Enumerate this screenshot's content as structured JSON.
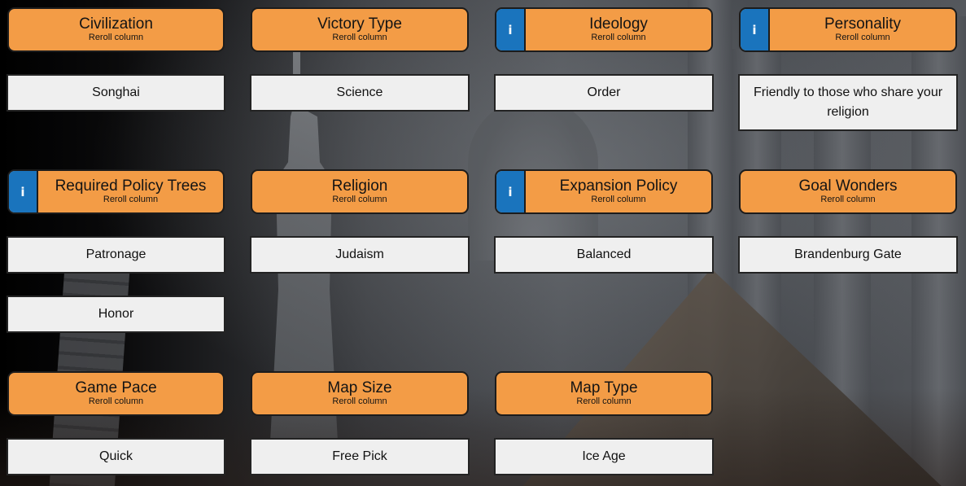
{
  "columns": {
    "civilization": {
      "title": "Civilization",
      "subtitle": "Reroll column",
      "has_info": false,
      "values": [
        "Songhai"
      ]
    },
    "victory_type": {
      "title": "Victory Type",
      "subtitle": "Reroll column",
      "has_info": false,
      "values": [
        "Science"
      ]
    },
    "ideology": {
      "title": "Ideology",
      "subtitle": "Reroll column",
      "has_info": true,
      "values": [
        "Order"
      ]
    },
    "personality": {
      "title": "Personality",
      "subtitle": "Reroll column",
      "has_info": true,
      "values": [
        "Friendly to those who share your religion"
      ]
    },
    "required_policy_trees": {
      "title": "Required Policy Trees",
      "subtitle": "Reroll column",
      "has_info": true,
      "values": [
        "Patronage",
        "Honor"
      ]
    },
    "religion": {
      "title": "Religion",
      "subtitle": "Reroll column",
      "has_info": false,
      "values": [
        "Judaism"
      ]
    },
    "expansion_policy": {
      "title": "Expansion Policy",
      "subtitle": "Reroll column",
      "has_info": true,
      "values": [
        "Balanced"
      ]
    },
    "goal_wonders": {
      "title": "Goal Wonders",
      "subtitle": "Reroll column",
      "has_info": false,
      "values": [
        "Brandenburg Gate"
      ]
    },
    "game_pace": {
      "title": "Game Pace",
      "subtitle": "Reroll column",
      "has_info": false,
      "values": [
        "Quick"
      ]
    },
    "map_size": {
      "title": "Map Size",
      "subtitle": "Reroll column",
      "has_info": false,
      "values": [
        "Free Pick"
      ]
    },
    "map_type": {
      "title": "Map Type",
      "subtitle": "Reroll column",
      "has_info": false,
      "values": [
        "Ice Age"
      ]
    }
  },
  "info_label": "i",
  "colors": {
    "header": "#f39c46",
    "info": "#1a74bd",
    "value_bg": "#efefef",
    "border": "#1c1c1c"
  }
}
